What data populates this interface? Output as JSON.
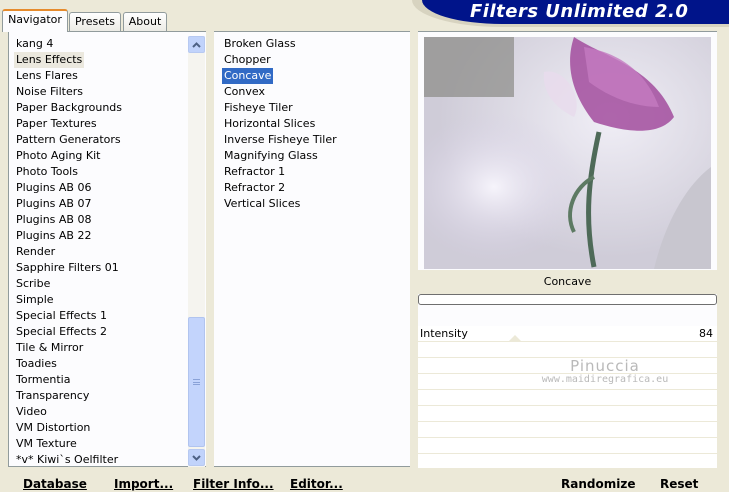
{
  "app": {
    "title": "Filters Unlimited 2.0"
  },
  "tabs": [
    {
      "label": "Navigator",
      "active": true
    },
    {
      "label": "Presets",
      "active": false
    },
    {
      "label": "About",
      "active": false
    }
  ],
  "categories": {
    "items": [
      "kang 4",
      "Lens Effects",
      "Lens Flares",
      "Noise Filters",
      "Paper Backgrounds",
      "Paper Textures",
      "Pattern Generators",
      "Photo Aging Kit",
      "Photo Tools",
      "Plugins AB 06",
      "Plugins AB 07",
      "Plugins AB 08",
      "Plugins AB 22",
      "Render",
      "Sapphire Filters 01",
      "Scribe",
      "Simple",
      "Special Effects 1",
      "Special Effects 2",
      "Tile & Mirror",
      "Toadies",
      "Tormentia",
      "Transparency",
      "Video",
      "VM Distortion",
      "VM Texture",
      "*v* Kiwi`s Oelfilter"
    ],
    "selected": "Lens Effects"
  },
  "filters": {
    "items": [
      "Broken Glass",
      "Chopper",
      "Concave",
      "Convex",
      "Fisheye Tiler",
      "Horizontal Slices",
      "Inverse Fisheye Tiler",
      "Magnifying Glass",
      "Refractor 1",
      "Refractor 2",
      "Vertical Slices"
    ],
    "selected": "Concave"
  },
  "preview": {
    "filter_name": "Concave",
    "progress": 0
  },
  "params": [
    {
      "label": "Intensity",
      "value": "84"
    }
  ],
  "watermark": {
    "name": "Pinuccia",
    "url": "www.maidiregrafica.eu"
  },
  "bottom": {
    "database": "Database",
    "import": "Import...",
    "filter_info": "Filter Info...",
    "editor": "Editor...",
    "randomize": "Randomize",
    "reset": "Reset"
  },
  "colors": {
    "background": "#ece9d8",
    "banner": "#00148a",
    "selection_blue": "#316ac5",
    "selection_gray": "#ebe8de",
    "tab_accent": "#e68b2c"
  },
  "icons": [
    "scroll-up-icon",
    "scroll-down-icon",
    "scroll-grip-icon"
  ]
}
